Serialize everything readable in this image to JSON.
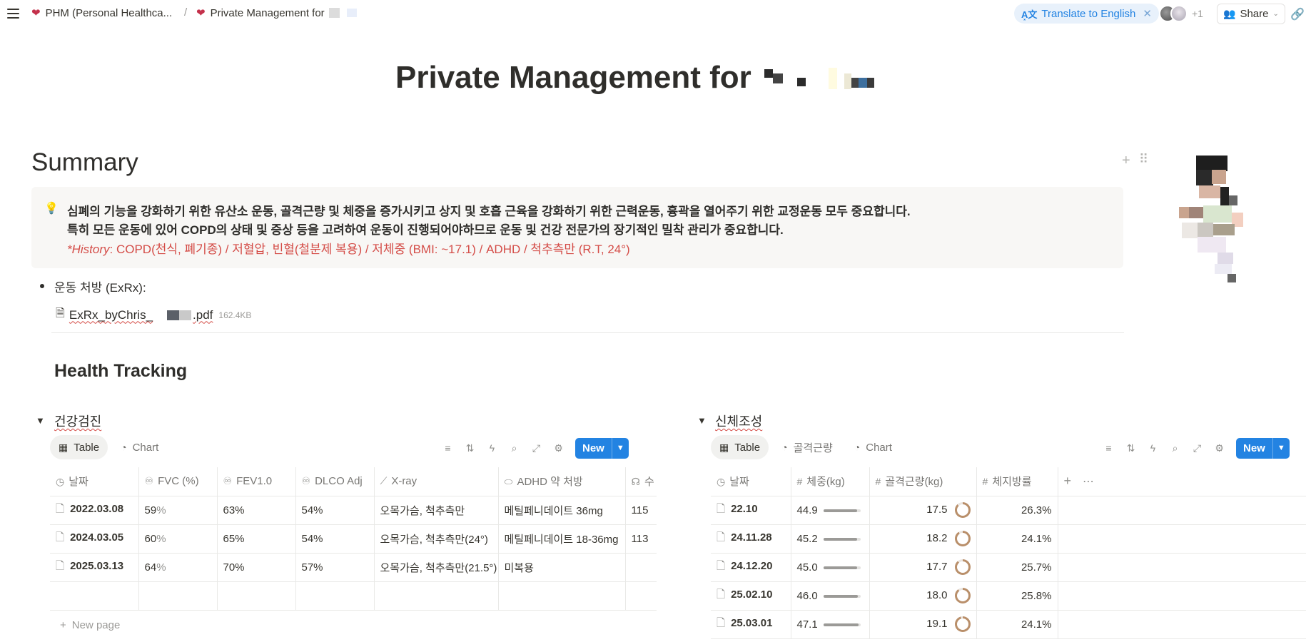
{
  "topbar": {
    "breadcrumb_1": "PHM (Personal Healthca...",
    "breadcrumb_sep": "/",
    "breadcrumb_2": "Private Management for",
    "translate_label": "Translate to English",
    "collaborators_extra": "+1",
    "share_label": "Share"
  },
  "page": {
    "title": "Private Management for"
  },
  "summary": {
    "heading": "Summary",
    "callout_line1": "심폐의 기능을 강화하기 위한 유산소 운동, 골격근량 및 체중을 증가시키고 상지 및 호흡 근육을 강화하기 위한 근력운동, 흉곽을 열어주기 위한 교정운동 모두 중요합니다.",
    "callout_line2": "특히 모든 운동에 있어 COPD의 상태 및 증상 등을 고려하여 운동이 진행되어야하므로 운동 및 건강 전문가의 장기적인 밀착 관리가 중요합니다.",
    "history_label": "*History",
    "history_text": ": COPD(천식, 폐기종) / 저혈압, 빈혈(철분제 복용) / 저체중 (BMI: ~17.1)  / ADHD / 척추측만 (R.T, 24°)",
    "bullet": "운동 처방 (ExRx):",
    "file_name_a": "ExRx_byChris_",
    "file_name_b": ".pdf",
    "file_size": "162.4KB"
  },
  "tracking": {
    "heading": "Health Tracking"
  },
  "db_left": {
    "title": "건강검진",
    "tabs": [
      "Table",
      "Chart"
    ],
    "new_label": "New",
    "columns": [
      "날짜",
      "FVC (%)",
      "FEV1.0",
      "DLCO Adj",
      "X-ray",
      "ADHD 약 처방",
      "수"
    ],
    "rows": [
      {
        "date": "2022.03.08",
        "fvc": "59",
        "fvc_unit": "%",
        "fev": "63%",
        "dlco": "54%",
        "xray": "오목가슴, 척추측만",
        "adhd": "메틸페니데이트 36mg",
        "extra": "115"
      },
      {
        "date": "2024.03.05",
        "fvc": "60",
        "fvc_unit": "%",
        "fev": "65%",
        "dlco": "54%",
        "xray": "오목가슴, 척추측만(24°)",
        "adhd": "메틸페니데이트 18-36mg",
        "extra": "113"
      },
      {
        "date": "2025.03.13",
        "fvc": "64",
        "fvc_unit": "%",
        "fev": "70%",
        "dlco": "57%",
        "xray": "오목가슴, 척추측만(21.5°)",
        "adhd": "미복용",
        "extra": ""
      }
    ],
    "new_page": "New page"
  },
  "db_right": {
    "title": "신체조성",
    "tabs": [
      "Table",
      "골격근량",
      "Chart"
    ],
    "new_label": "New",
    "columns": [
      "날짜",
      "체중(kg)",
      "골격근량(kg)",
      "체지방률"
    ],
    "rows": [
      {
        "date": "22.10",
        "weight": "44.9",
        "weight_fill": 0.9,
        "muscle": "17.5",
        "muscle_fill": 0.88,
        "fat": "26.3%"
      },
      {
        "date": "24.11.28",
        "weight": "45.2",
        "weight_fill": 0.9,
        "muscle": "18.2",
        "muscle_fill": 0.91,
        "fat": "24.1%"
      },
      {
        "date": "24.12.20",
        "weight": "45.0",
        "weight_fill": 0.9,
        "muscle": "17.7",
        "muscle_fill": 0.89,
        "fat": "25.7%"
      },
      {
        "date": "25.02.10",
        "weight": "46.0",
        "weight_fill": 0.92,
        "muscle": "18.0",
        "muscle_fill": 0.9,
        "fat": "25.8%"
      },
      {
        "date": "25.03.01",
        "weight": "47.1",
        "weight_fill": 0.94,
        "muscle": "19.1",
        "muscle_fill": 0.96,
        "fat": "24.1%"
      }
    ]
  },
  "colors": {
    "accent": "#2383e2",
    "red_text": "#d44c47",
    "ring": "#b98f6a"
  }
}
